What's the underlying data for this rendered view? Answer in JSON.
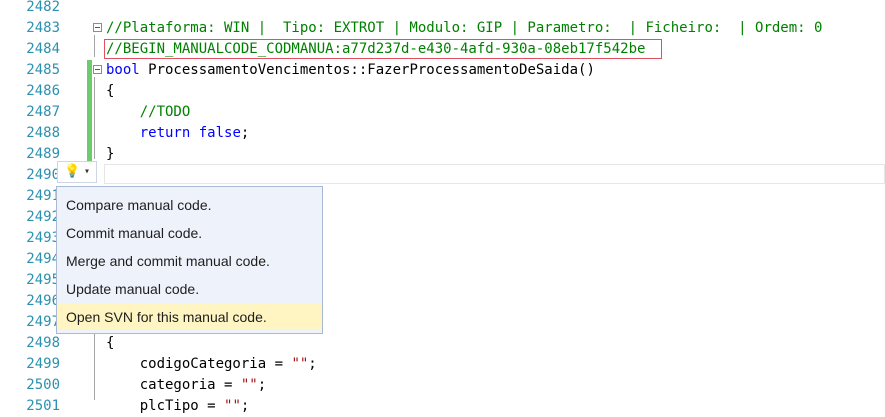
{
  "editor": {
    "line_numbers": [
      "2482",
      "2483",
      "2484",
      "2485",
      "2486",
      "2487",
      "2488",
      "2489",
      "2490",
      "2491",
      "2492",
      "2493",
      "2494",
      "2495",
      "2496",
      "2497",
      "2498",
      "2499",
      "2500",
      "2501"
    ],
    "header_comment": "//Plataforma: WIN |  Tipo: EXTROT | Modulo: GIP | Parametro:  | Ficheiro:  | Ordem: 0",
    "begin_marker": "//BEGIN_MANUALCODE_CODMANUA:a77d237d-e430-4afd-930a-08eb17f542be",
    "func_type": "bool",
    "func_name": " ProcessamentoVencimentos::FazerProcessamentoDeSaida()",
    "open_brace": "{",
    "todo_comment": "    //TODO",
    "return_kw": "    return",
    "return_val": " false",
    "semicolon": ";",
    "close_brace": "}",
    "open_brace_2": "{",
    "assign1_var": "    codigoCategoria = ",
    "assign2_var": "    categoria = ",
    "assign3_var": "    plcTipo = ",
    "empty_string": "\"\"",
    "semicolon2": ";"
  },
  "lightbulb": {
    "icon": "lightbulb-icon",
    "glyph": "💡",
    "arrow": "▾"
  },
  "context_menu": {
    "items": [
      {
        "label": "Compare manual code."
      },
      {
        "label": "Commit manual code."
      },
      {
        "label": "Merge and commit manual code."
      },
      {
        "label": "Update manual code."
      },
      {
        "label": "Open SVN for this manual code."
      }
    ],
    "selected_index": 4,
    "selected_color": "#fff5c2"
  }
}
